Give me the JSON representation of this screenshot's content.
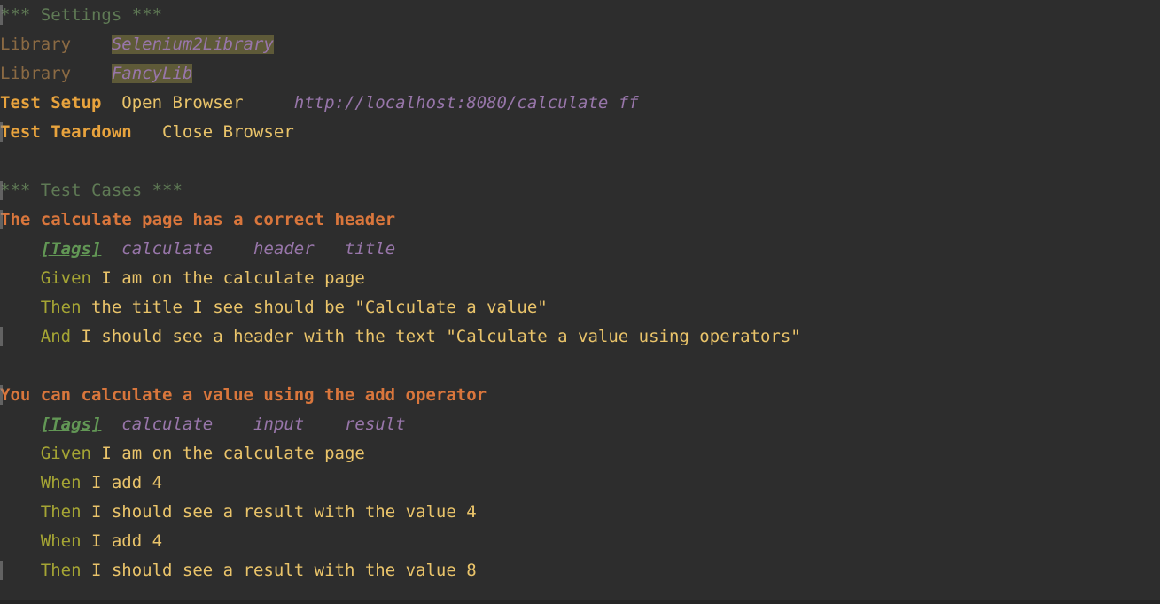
{
  "editor": {
    "background_color": "#2d2d2d",
    "bottom_bar_color": "#262626",
    "colors": {
      "section_header": "#5f7a55",
      "setting_keyword": "#8b6a43",
      "argument": "#9876aa",
      "highlight": "#5e5a38",
      "keyword_name": "#e8a33d",
      "test_name": "#d9763c",
      "keyword_call": "#eac46a",
      "bdd_prefix": "#a5a534",
      "tags_label": "#629755",
      "tag_value": "#9876aa"
    }
  },
  "lines": [
    {
      "id": "l1",
      "gutter": true,
      "sect": "*** Settings ***"
    },
    {
      "id": "l2",
      "gutter": false,
      "setting": "Library",
      "gap1": "    ",
      "arg": "Selenium2Library"
    },
    {
      "id": "l3",
      "gutter": false,
      "setting": "Library",
      "gap1": "    ",
      "arg": "FancyLib"
    },
    {
      "id": "l4",
      "gutter": false,
      "kwname": "Test Setup",
      "gap1": "  ",
      "kwcall": "Open Browser",
      "gap2": "     ",
      "arg": "http://localhost:8080/calculate ff"
    },
    {
      "id": "l5",
      "gutter": true,
      "kwname": "Test Teardown",
      "gap1": "   ",
      "kwcall": "Close Browser"
    },
    {
      "id": "l6",
      "gutter": false,
      "blank": true
    },
    {
      "id": "l7",
      "gutter": true,
      "sect": "*** Test Cases ***"
    },
    {
      "id": "l8",
      "gutter": true,
      "testname": "The calculate page has a correct header"
    },
    {
      "id": "l9",
      "gutter": false,
      "indent": "    ",
      "tags": "[Tags]",
      "gap1": "  ",
      "tagvals": "calculate    header   title"
    },
    {
      "id": "l10",
      "gutter": false,
      "indent": "    ",
      "bdd": "Given",
      "rest": " I am on the calculate page"
    },
    {
      "id": "l11",
      "gutter": false,
      "indent": "    ",
      "bdd": "Then",
      "rest": " the title I see should be \"Calculate a value\""
    },
    {
      "id": "l12",
      "gutter": true,
      "indent": "    ",
      "bdd": "And",
      "rest": " I should see a header with the text \"Calculate a value using operators\""
    },
    {
      "id": "l13",
      "gutter": false,
      "blank": true
    },
    {
      "id": "l14",
      "gutter": true,
      "testname": "You can calculate a value using the add operator"
    },
    {
      "id": "l15",
      "gutter": false,
      "indent": "    ",
      "tags": "[Tags]",
      "gap1": "  ",
      "tagvals": "calculate    input    result"
    },
    {
      "id": "l16",
      "gutter": false,
      "indent": "    ",
      "bdd": "Given",
      "rest": " I am on the calculate page"
    },
    {
      "id": "l17",
      "gutter": false,
      "indent": "    ",
      "bdd": "When",
      "rest": " I add 4"
    },
    {
      "id": "l18",
      "gutter": false,
      "indent": "    ",
      "bdd": "Then",
      "rest": " I should see a result with the value 4"
    },
    {
      "id": "l19",
      "gutter": false,
      "indent": "    ",
      "bdd": "When",
      "rest": " I add 4"
    },
    {
      "id": "l20",
      "gutter": true,
      "indent": "    ",
      "bdd": "Then",
      "rest": " I should see a result with the value 8"
    }
  ]
}
